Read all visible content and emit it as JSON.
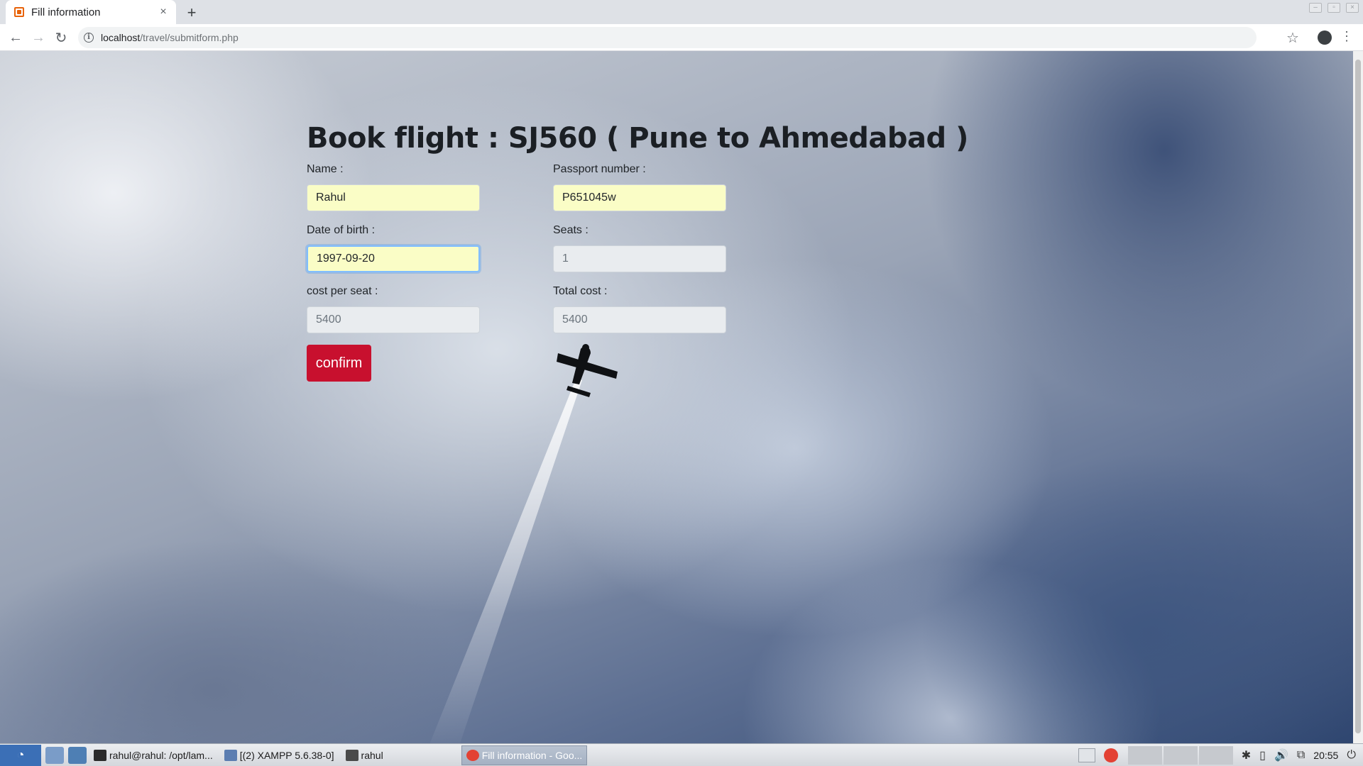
{
  "browser": {
    "tab_title": "Fill information",
    "new_tab": "+",
    "close_tab": "×",
    "url_host": "localhost",
    "url_path": "/travel/submitform.php",
    "back": "←",
    "forward": "→",
    "reload": "↻",
    "star": "☆",
    "menu": "⋮"
  },
  "form": {
    "heading": "Book flight : SJ560 ( Pune to Ahmedabad )",
    "name_label": "Name :",
    "name_value": "Rahul",
    "passport_label": "Passport number :",
    "passport_value": "P651045w",
    "dob_label": "Date of birth :",
    "dob_value": "1997-09-20",
    "seats_label": "Seats :",
    "seats_value": "1",
    "cost_label": "cost per seat :",
    "cost_value": "5400",
    "total_label": "Total cost :",
    "total_value": "5400",
    "confirm_label": "confirm"
  },
  "taskbar": {
    "terminal": "rahul@rahul: /opt/lam...",
    "xampp": "[(2) XAMPP 5.6.38-0]",
    "files": "rahul",
    "chrome": "Fill information - Goo...",
    "clock": "20:55"
  },
  "colors": {
    "confirm": "#c8102e",
    "autofill": "#fafdc6",
    "readonly": "#e9ecef"
  }
}
